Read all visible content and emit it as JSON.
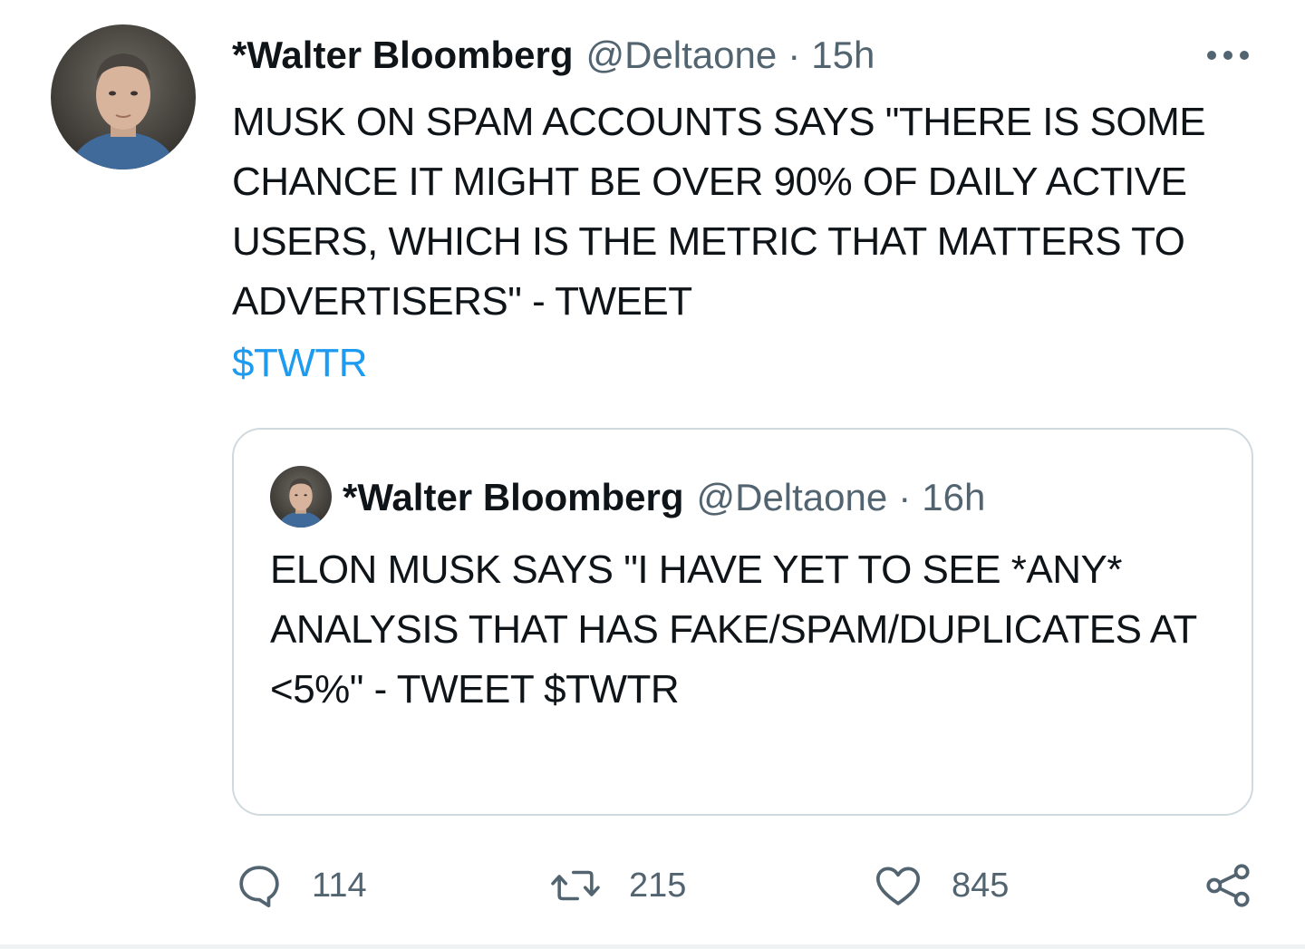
{
  "tweet": {
    "author_name": "*Walter Bloomberg",
    "author_handle": "@Deltaone",
    "separator": "·",
    "timestamp": "15h",
    "text": "MUSK ON SPAM ACCOUNTS SAYS \"THERE IS SOME CHANCE IT MIGHT BE OVER 90% OF DAILY ACTIVE USERS, WHICH IS THE METRIC THAT MATTERS TO ADVERTISERS\" - TWEET",
    "cashtag": "$TWTR",
    "more_icon": "more-horizontal-icon"
  },
  "quoted_tweet": {
    "author_name": "*Walter Bloomberg",
    "author_handle": "@Deltaone",
    "separator": "·",
    "timestamp": "16h",
    "text": "ELON MUSK SAYS \"I HAVE YET TO SEE *ANY* ANALYSIS THAT HAS FAKE/SPAM/DUPLICATES AT <5%\" - TWEET $TWTR"
  },
  "actions": {
    "reply": {
      "icon": "reply-icon",
      "count": "114"
    },
    "retweet": {
      "icon": "retweet-icon",
      "count": "215"
    },
    "like": {
      "icon": "heart-icon",
      "count": "845"
    },
    "share": {
      "icon": "share-icon"
    }
  },
  "colors": {
    "text_primary": "#0f1419",
    "text_secondary": "#536471",
    "link": "#1d9bf0",
    "border": "#cfd9de"
  }
}
